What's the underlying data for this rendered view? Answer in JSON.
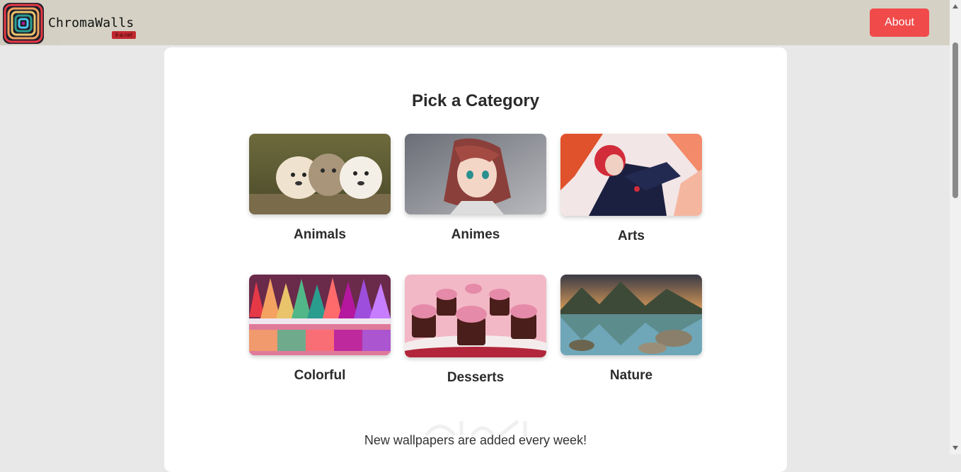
{
  "header": {
    "brand_name": "ChromaWalls",
    "brand_tag": "ll-a.net",
    "about_label": "About",
    "logo_icon": "chroma-swirl-logo-icon"
  },
  "main": {
    "title": "Pick a Category",
    "categories": [
      {
        "label": "Animals",
        "thumb": "animals-photo"
      },
      {
        "label": "Animes",
        "thumb": "anime-girl-photo"
      },
      {
        "label": "Arts",
        "thumb": "anime-art-photo"
      },
      {
        "label": "Colorful",
        "thumb": "colorful-forest-photo"
      },
      {
        "label": "Desserts",
        "thumb": "cupcakes-photo"
      },
      {
        "label": "Nature",
        "thumb": "mountain-lake-photo"
      }
    ],
    "footer_note": "New wallpapers are added every week!"
  },
  "colors": {
    "header_bg": "#d5d2c5",
    "about_button": "#f04a4a",
    "page_bg": "#e8e8e8",
    "card_bg": "#ffffff"
  }
}
